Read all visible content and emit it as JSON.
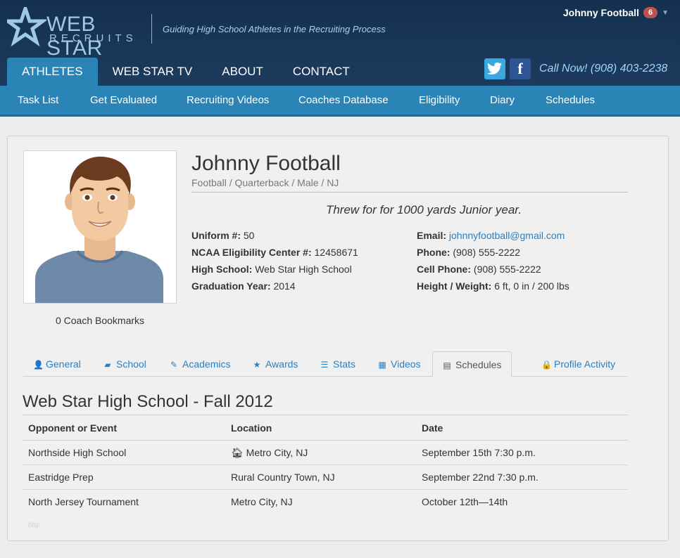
{
  "brand": {
    "logo_line1": "WEB STAR",
    "logo_line2": "RECRUITS",
    "tagline": "Guiding High School Athletes in the Recruiting Process"
  },
  "user": {
    "name": "Johnny Football",
    "notification_count": "6"
  },
  "main_nav": [
    {
      "label": "ATHLETES",
      "active": true
    },
    {
      "label": "WEB STAR TV"
    },
    {
      "label": "ABOUT"
    },
    {
      "label": "CONTACT"
    }
  ],
  "social": {
    "twitter_icon": "twitter-bird",
    "facebook_icon": "f"
  },
  "call_text": "Call Now! (908) 403-2238",
  "sub_nav": [
    "Task List",
    "Get Evaluated",
    "Recruiting Videos",
    "Coaches Database",
    "Eligibility",
    "Diary",
    "Schedules"
  ],
  "profile": {
    "name": "Johnny Football",
    "subtitle": "Football / Quarterback / Male / NJ",
    "quote": "Threw for for 1000 yards Junior year.",
    "bookmarks": "0 Coach Bookmarks",
    "left_fields": [
      {
        "label": "Uniform #:",
        "value": "50"
      },
      {
        "label": "NCAA Eligibility Center #:",
        "value": "12458671"
      },
      {
        "label": "High School:",
        "value": "Web Star High School"
      },
      {
        "label": "Graduation Year:",
        "value": "2014"
      }
    ],
    "right_fields": [
      {
        "label": "Email:",
        "value": "johnnyfootball@gmail.com"
      },
      {
        "label": "Phone:",
        "value": "(908) 555-2222"
      },
      {
        "label": "Cell Phone:",
        "value": "(908) 555-2222"
      },
      {
        "label": "Height / Weight:",
        "value": "6 ft, 0 in / 200 lbs"
      }
    ]
  },
  "profile_tabs": [
    {
      "label": "General",
      "icon": "user-icon"
    },
    {
      "label": "School",
      "icon": "book-icon"
    },
    {
      "label": "Academics",
      "icon": "pencil-icon"
    },
    {
      "label": "Awards",
      "icon": "star-icon"
    },
    {
      "label": "Stats",
      "icon": "list-icon"
    },
    {
      "label": "Videos",
      "icon": "film-icon"
    },
    {
      "label": "Schedules",
      "icon": "calendar-icon",
      "active": true
    },
    {
      "label": "Profile Activity",
      "icon": "lock-icon"
    }
  ],
  "schedule": {
    "title": "Web Star High School - Fall 2012",
    "headers": [
      "Opponent or Event",
      "Location",
      "Date"
    ],
    "rows": [
      {
        "opponent": "Northside High School",
        "location": "Metro City, NJ",
        "home": true,
        "date": "September 15th 7:30 p.m."
      },
      {
        "opponent": "Eastridge Prep",
        "location": "Rural Country Town, NJ",
        "date": "September 22nd 7:30 p.m."
      },
      {
        "opponent": "North Jersey Tournament",
        "location": "Metro City, NJ",
        "date": "October 12th—14th"
      }
    ],
    "footer_text": "http"
  },
  "colors": {
    "header_bg": "#15304f",
    "accent": "#2a84b6",
    "link": "#2a7fc0",
    "badge": "#c0504d"
  }
}
